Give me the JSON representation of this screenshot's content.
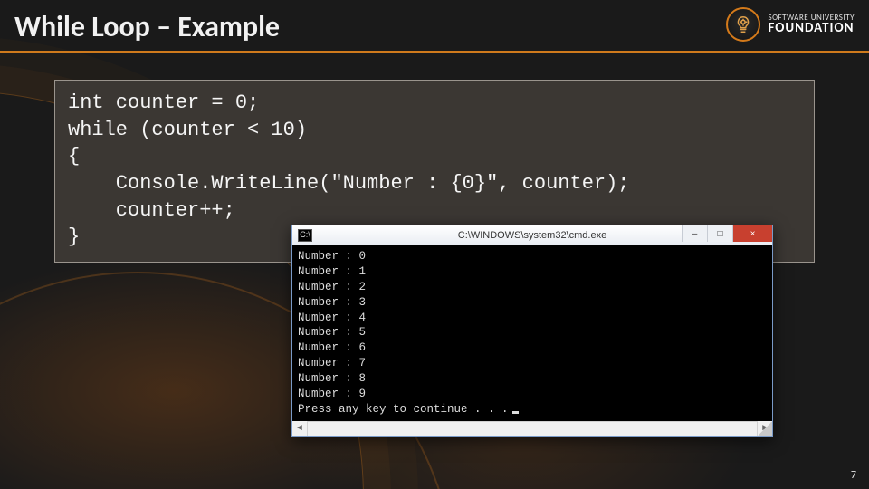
{
  "header": {
    "title": "While Loop – Example"
  },
  "logo": {
    "line1": "SOFTWARE UNIVERSITY",
    "line2": "FOUNDATION",
    "icon": "lightbulb-gear-icon"
  },
  "code": {
    "lines": [
      "int counter = 0;",
      "while (counter < 10)",
      "{",
      "    Console.WriteLine(\"Number : {0}\", counter);",
      "    counter++;",
      "}"
    ]
  },
  "cmd": {
    "title": "C:\\WINDOWS\\system32\\cmd.exe",
    "icon_glyph": "C:\\",
    "controls": {
      "minimize": "–",
      "maximize": "□",
      "close": "×"
    },
    "output_lines": [
      "Number : 0",
      "Number : 1",
      "Number : 2",
      "Number : 3",
      "Number : 4",
      "Number : 5",
      "Number : 6",
      "Number : 7",
      "Number : 8",
      "Number : 9",
      "Press any key to continue . . ."
    ],
    "scroll": {
      "left": "◄",
      "right": "►"
    }
  },
  "page_number": "7"
}
